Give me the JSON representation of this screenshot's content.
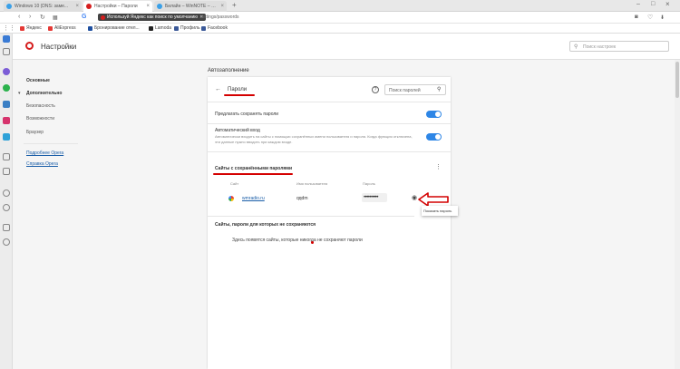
{
  "browser": {
    "tabs": [
      {
        "label": "Windows 10 (DNS: заме...",
        "active": false
      },
      {
        "label": "Настройки – Пароли",
        "active": true
      },
      {
        "label": "Билайн – WinNOTE – Win...",
        "active": false
      }
    ],
    "new_tab": "+",
    "address": {
      "badge": "Используй Яндекс как поиск по умолчанию",
      "url": "settings/passwords"
    },
    "bookmarks": [
      "Яндекс",
      "AliExpress",
      "Бронирование отел...",
      "Lamoda",
      "Профиль",
      "Facebook"
    ]
  },
  "settings": {
    "title": "Настройки",
    "search_placeholder": "Поиск настроек",
    "menu": {
      "basic": "Основные",
      "advanced": "Дополнительно",
      "security": "Безопасность",
      "features": "Возможности",
      "browser": "Браузер",
      "about": "Подробнее Opera",
      "help": "Справка Opera"
    },
    "section_title": "Автозаполнение",
    "passwords": {
      "back": "←",
      "title": "Пароли",
      "search_placeholder": "Поиск паролей",
      "offer_save": "Предлагать сохранять пароли",
      "autologin_title": "Автоматический вход",
      "autologin_desc": "Автоматически входить на сайты с помощью сохранённых имени пользователя и пароля. Когда функция отключена, эти данные нужно вводить при каждом входе.",
      "saved_title": "Сайты с сохранёнными паролями",
      "columns": {
        "site": "Сайт",
        "username": "Имя пользователя",
        "password": "Пароль"
      },
      "entries": [
        {
          "site": "wmradio.ru",
          "username": "qqdm",
          "password": "••••••••••"
        }
      ],
      "show_password_tooltip": "Показать пароль",
      "never_saved_title": "Сайты, пароли для которых не сохраняются",
      "never_saved_empty": "Здесь появятся сайты, которые никогда не сохраняют пароли"
    }
  },
  "colors": {
    "opera_red": "#d51d1d",
    "toggle_blue": "#2e86e6",
    "annotation_red": "#d40000"
  }
}
